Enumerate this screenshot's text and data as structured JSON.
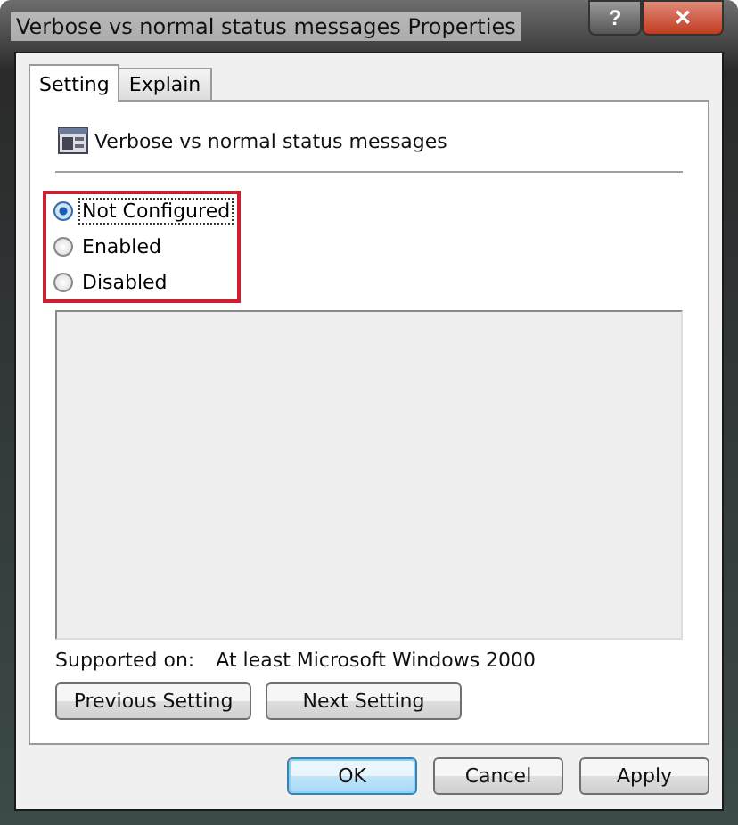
{
  "window": {
    "title": "Verbose vs normal status messages Properties",
    "help_button": "?",
    "close_button": "✕"
  },
  "tabs": [
    {
      "label": "Setting",
      "selected": true
    },
    {
      "label": "Explain",
      "selected": false
    }
  ],
  "policy_title": "Verbose vs normal status messages",
  "options": [
    {
      "label": "Not Configured",
      "selected": true
    },
    {
      "label": "Enabled",
      "selected": false
    },
    {
      "label": "Disabled",
      "selected": false
    }
  ],
  "supported_on": {
    "label": "Supported on:",
    "value": "At least Microsoft Windows 2000"
  },
  "nav_buttons": [
    "Previous Setting",
    "Next Setting"
  ],
  "buttons": [
    {
      "label": "OK",
      "default": true
    },
    {
      "label": "Cancel",
      "default": false
    },
    {
      "label": "Apply",
      "default": false
    }
  ]
}
